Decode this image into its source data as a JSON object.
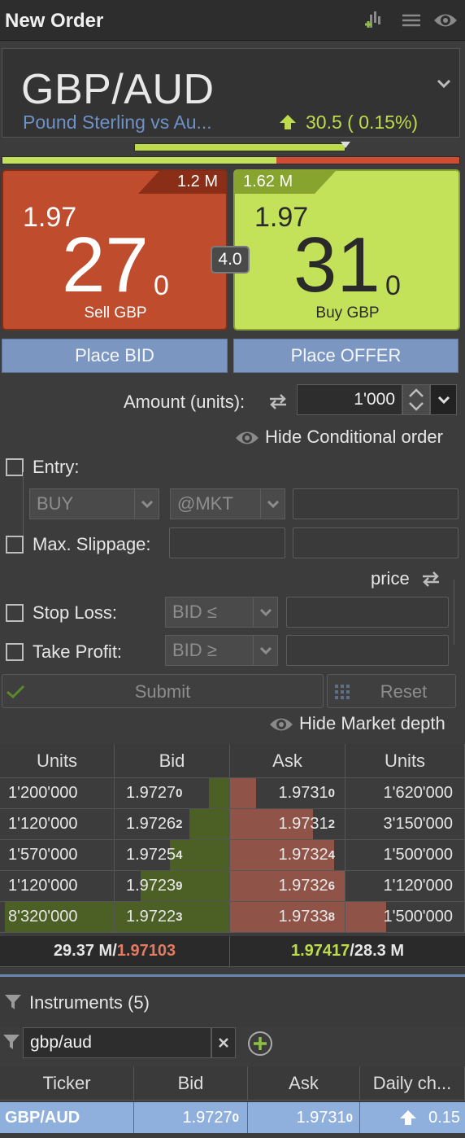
{
  "header": {
    "title": "New Order"
  },
  "instrument": {
    "pair": "GBP/AUD",
    "name": "Pound Sterling vs Au...",
    "change": "30.5 ( 0.15%)",
    "colors": {
      "sell": "#bf4c2c",
      "buy": "#c3e25a",
      "accent": "#6e92c6",
      "up": "#bedb4c"
    }
  },
  "sentiment": {
    "buy_fraction": 0.6
  },
  "sell": {
    "volume": "1.2 M",
    "price_prefix": "1.97",
    "price_big": "27",
    "price_pip": "0",
    "label": "Sell GBP"
  },
  "buy": {
    "volume": "1.62 M",
    "price_prefix": "1.97",
    "price_big": "31",
    "price_pip": "0",
    "label": "Buy GBP"
  },
  "spread": "4.0",
  "actions": {
    "place_bid": "Place BID",
    "place_offer": "Place OFFER"
  },
  "amount": {
    "label": "Amount (units):",
    "value": "1'000"
  },
  "conditional": {
    "hide_label": "Hide Conditional order",
    "entry_label": "Entry:",
    "entry_side": "BUY",
    "entry_type": "@MKT",
    "slippage_label": "Max. Slippage:",
    "price_label": "price",
    "stop_loss_label": "Stop Loss:",
    "stop_loss_cond": "BID ≤",
    "take_profit_label": "Take Profit:",
    "take_profit_cond": "BID ≥",
    "submit": "Submit",
    "reset": "Reset"
  },
  "market_depth": {
    "hide_label": "Hide Market depth",
    "columns": [
      "Units",
      "Bid",
      "Ask",
      "Units"
    ],
    "rows": [
      {
        "bid_units": "1'200'000",
        "bid": "1.9727",
        "bid_sub": "0",
        "ask": "1.9731",
        "ask_sub": "0",
        "ask_units": "1'620'000",
        "bid_fill": 0.18,
        "ask_fill": 0.23
      },
      {
        "bid_units": "1'120'000",
        "bid": "1.9726",
        "bid_sub": "2",
        "ask": "1.9731",
        "ask_sub": "2",
        "ask_units": "3'150'000",
        "bid_fill": 0.35,
        "ask_fill": 0.72
      },
      {
        "bid_units": "1'570'000",
        "bid": "1.9725",
        "bid_sub": "4",
        "ask": "1.9732",
        "ask_sub": "4",
        "ask_units": "1'500'000",
        "bid_fill": 0.52,
        "ask_fill": 0.91
      },
      {
        "bid_units": "1'120'000",
        "bid": "1.9723",
        "bid_sub": "9",
        "ask": "1.9732",
        "ask_sub": "6",
        "ask_units": "1'120'000",
        "bid_fill": 0.77,
        "ask_fill": 1.0
      },
      {
        "bid_units": "8'320'000",
        "bid": "1.9722",
        "bid_sub": "3",
        "ask": "1.9733",
        "ask_sub": "8",
        "ask_units": "1'500'000",
        "bid_fill": 1.0,
        "ask_fill": 1.0,
        "bid_units_fill": 0.96,
        "ask_units_fill": 0.34
      }
    ],
    "total_bid": "29.37 M/",
    "vwap_bid": "1.97103",
    "vwap_ask": "1.97417",
    "total_ask": "/28.3 M"
  },
  "instruments": {
    "header": "Instruments (5)",
    "filter": "gbp/aud",
    "columns": [
      "Ticker",
      "Bid",
      "Ask",
      "Daily ch..."
    ],
    "row": {
      "ticker": "GBP/AUD",
      "bid": "1.9727",
      "bid_sub": "0",
      "ask": "1.9731",
      "ask_sub": "0",
      "change": "0.15"
    }
  }
}
